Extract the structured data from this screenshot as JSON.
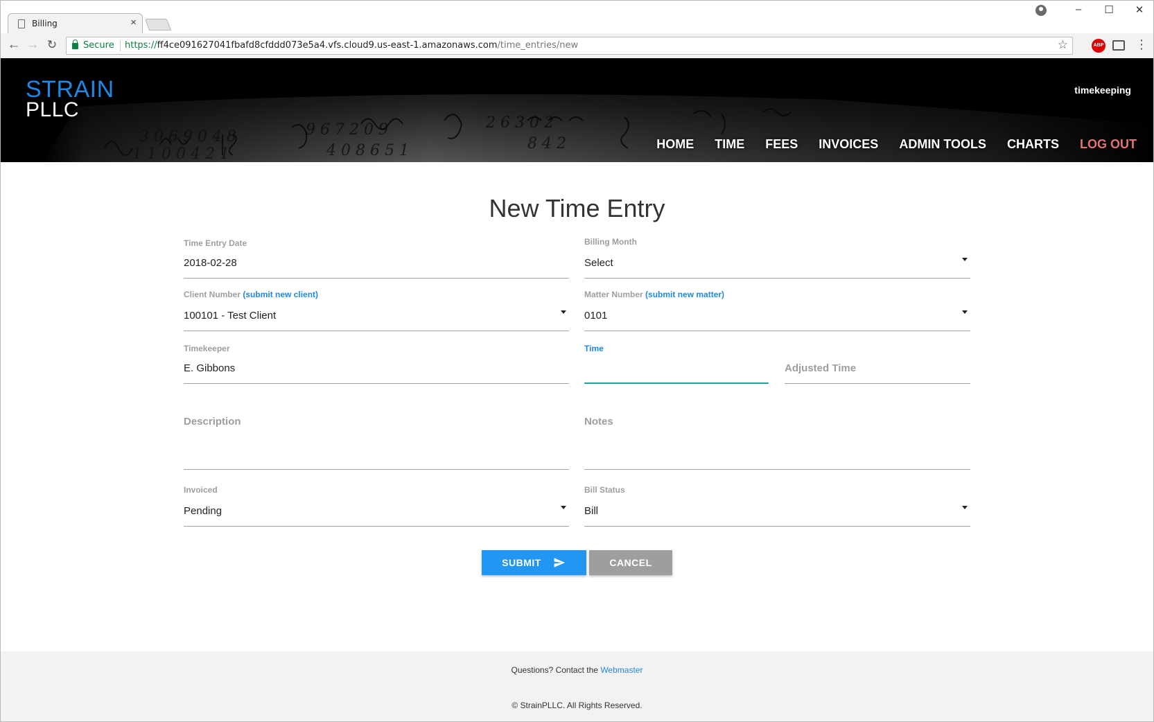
{
  "browser": {
    "tab_title": "Billing",
    "tab_close": "×",
    "secure_label": "Secure",
    "url_scheme": "https://",
    "url_host": "ff4ce091627041fbafd8cfddd073e5a4.vfs.cloud9.us-east-1.amazonaws.com",
    "url_path": "/time_entries/new",
    "adblock_label": "ABP",
    "window_controls": {
      "minimize": "–",
      "maximize": "☐",
      "close": "✕"
    }
  },
  "header": {
    "logo_top": "STRAIN",
    "logo_bottom": "PLLC",
    "user_label": "timekeeping",
    "nav": [
      {
        "label": "HOME"
      },
      {
        "label": "TIME"
      },
      {
        "label": "FEES"
      },
      {
        "label": "INVOICES"
      },
      {
        "label": "ADMIN TOOLS"
      },
      {
        "label": "CHARTS"
      },
      {
        "label": "LOG OUT"
      }
    ],
    "logout_color": "#e57373"
  },
  "form": {
    "title": "New Time Entry",
    "time_entry_date": {
      "label": "Time Entry Date",
      "value": "2018-02-28"
    },
    "billing_month": {
      "label": "Billing Month",
      "value": "Select"
    },
    "client_number": {
      "label": "Client Number",
      "link": "(submit new client)",
      "value": "100101 - Test Client"
    },
    "matter_number": {
      "label": "Matter Number",
      "link": "(submit new matter)",
      "value": "0101"
    },
    "timekeeper": {
      "label": "Timekeeper",
      "value": "E. Gibbons"
    },
    "time": {
      "label": "Time",
      "value": ""
    },
    "adjusted_time": {
      "placeholder": "Adjusted Time"
    },
    "description": {
      "placeholder": "Description"
    },
    "notes": {
      "placeholder": "Notes"
    },
    "invoiced": {
      "label": "Invoiced",
      "value": "Pending"
    },
    "bill_status": {
      "label": "Bill Status",
      "value": "Bill"
    },
    "submit_label": "SUBMIT",
    "cancel_label": "CANCEL"
  },
  "footer": {
    "question": "Questions? Contact the",
    "webmaster": "Webmaster",
    "copyright": "© StrainPLLC. All Rights Reserved."
  },
  "colors": {
    "accent": "#1e88e5",
    "submit": "#2196f3",
    "cancel": "#9e9e9e",
    "active_underline": "#26a69a"
  }
}
